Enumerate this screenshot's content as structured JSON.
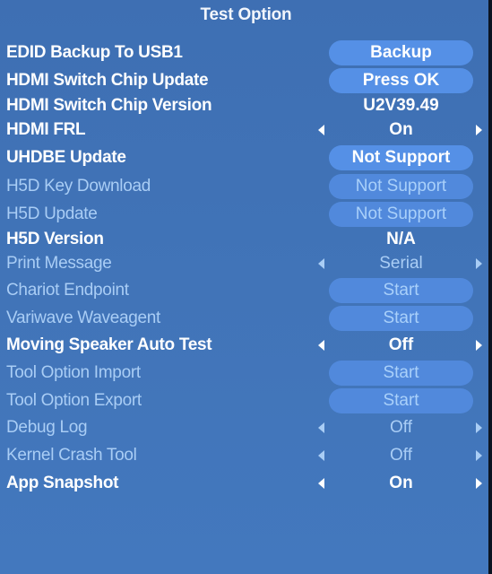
{
  "window": {
    "title": "Test Option"
  },
  "menu": {
    "items": [
      {
        "label": "EDID Backup To USB1",
        "type": "button",
        "value": "Backup",
        "enabled": true
      },
      {
        "label": "HDMI Switch Chip Update",
        "type": "button",
        "value": "Press OK",
        "enabled": true
      },
      {
        "label": "HDMI Switch Chip Version",
        "type": "text",
        "value": "U2V39.49",
        "enabled": true
      },
      {
        "label": "HDMI FRL",
        "type": "selector",
        "value": "On",
        "enabled": true
      },
      {
        "label": "UHDBE Update",
        "type": "button",
        "value": "Not Support",
        "enabled": true
      },
      {
        "label": "H5D Key Download",
        "type": "button",
        "value": "Not Support",
        "enabled": false
      },
      {
        "label": "H5D Update",
        "type": "button",
        "value": "Not Support",
        "enabled": false
      },
      {
        "label": "H5D Version",
        "type": "text",
        "value": "N/A",
        "enabled": true
      },
      {
        "label": "Print Message",
        "type": "selector",
        "value": "Serial",
        "enabled": false
      },
      {
        "label": "Chariot Endpoint",
        "type": "button",
        "value": "Start",
        "enabled": false
      },
      {
        "label": "Variwave Waveagent",
        "type": "button",
        "value": "Start",
        "enabled": false
      },
      {
        "label": "Moving Speaker Auto Test",
        "type": "selector",
        "value": "Off",
        "enabled": true
      },
      {
        "label": "Tool Option Import",
        "type": "button",
        "value": "Start",
        "enabled": false
      },
      {
        "label": "Tool Option Export",
        "type": "button",
        "value": "Start",
        "enabled": false
      },
      {
        "label": "Debug Log",
        "type": "selector",
        "value": "Off",
        "enabled": false
      },
      {
        "label": "Kernel Crash Tool",
        "type": "selector",
        "value": "Off",
        "enabled": false
      },
      {
        "label": "App Snapshot",
        "type": "selector",
        "value": "On",
        "enabled": true
      }
    ]
  },
  "icons": {
    "left_arrow": "triangle-left",
    "right_arrow": "triangle-right"
  },
  "colors": {
    "background": "#4174b8",
    "pill": "#5590e6",
    "enabled_text": "#ffffff",
    "disabled_text": "#a9cdf5"
  }
}
